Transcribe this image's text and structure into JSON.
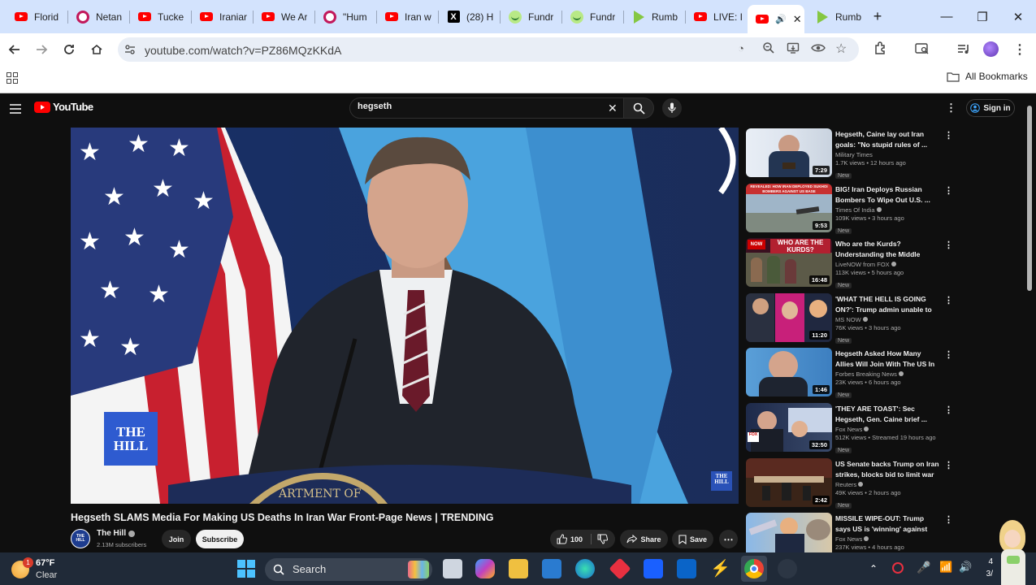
{
  "browser": {
    "tabs": [
      {
        "title": "Florid",
        "icon": "youtube-icon"
      },
      {
        "title": "Netan",
        "icon": "ring-icon"
      },
      {
        "title": "Tucke",
        "icon": "youtube-icon"
      },
      {
        "title": "Iraniar",
        "icon": "youtube-icon"
      },
      {
        "title": "We Ar",
        "icon": "youtube-icon"
      },
      {
        "title": "\"Hum",
        "icon": "ring-icon"
      },
      {
        "title": "Iran w",
        "icon": "youtube-icon"
      },
      {
        "title": "(28) H",
        "icon": "x-icon"
      },
      {
        "title": "Fundr",
        "icon": "fundraise-icon"
      },
      {
        "title": "Fundr",
        "icon": "fundraise-icon"
      },
      {
        "title": "Rumb",
        "icon": "rumble-icon"
      },
      {
        "title": "LIVE: I",
        "icon": "youtube-icon"
      },
      {
        "title": "",
        "icon": "youtube-icon"
      },
      {
        "title": "Rumb",
        "icon": "rumble-icon"
      }
    ],
    "url": "youtube.com/watch?v=PZ86MQzKKdA",
    "bookmarks_label": "All Bookmarks"
  },
  "youtube": {
    "logo_text": "YouTube",
    "search_value": "hegseth",
    "sign_in_label": "Sign in",
    "video": {
      "title": "Hegseth SLAMS Media For Making US Deaths In Iran War Front-Page News | TRENDING",
      "channel": "The Hill",
      "subscribers": "2.13M subscribers",
      "join_label": "Join",
      "subscribe_label": "Subscribe",
      "likes": "100",
      "share_label": "Share",
      "save_label": "Save",
      "watermark": "THE HILL",
      "podium_text": "ARTMENT OF"
    },
    "recommendations": [
      {
        "title": "Hegseth, Caine lay out Iran goals: \"No stupid rules of ...",
        "channel": "Military Times",
        "verified": false,
        "meta": "1.7K views • 12 hours ago",
        "duration": "7:29",
        "badge": "New"
      },
      {
        "title": "BIG! Iran Deploys Russian Bombers To Wipe Out U.S. ...",
        "channel": "Times Of India",
        "verified": true,
        "meta": "109K views • 3 hours ago",
        "duration": "9:53",
        "badge": "New"
      },
      {
        "title": "Who are the Kurds? Understanding the Middle East...",
        "channel": "LiveNOW from FOX",
        "verified": true,
        "meta": "113K views • 5 hours ago",
        "duration": "16:48",
        "badge": "New"
      },
      {
        "title": "'WHAT THE HELL IS GOING ON?': Trump admin unable to ...",
        "channel": "MS NOW",
        "verified": true,
        "meta": "76K views • 3 hours ago",
        "duration": "11:20",
        "badge": "New"
      },
      {
        "title": "Hegseth Asked How Many Allies Will Join With The US In ...",
        "channel": "Forbes Breaking News",
        "verified": true,
        "meta": "23K views • 6 hours ago",
        "duration": "1:46",
        "badge": "New"
      },
      {
        "title": "'THEY ARE TOAST': Sec Hegseth, Gen. Caine brief ...",
        "channel": "Fox News",
        "verified": true,
        "meta": "512K views • Streamed 19 hours ago",
        "duration": "32:50",
        "badge": "New"
      },
      {
        "title": "US Senate backs Trump on Iran strikes, blocks bid to limit war ...",
        "channel": "Reuters",
        "verified": true,
        "meta": "49K views • 2 hours ago",
        "duration": "2:42",
        "badge": "New"
      },
      {
        "title": "MISSILE WIPE-OUT: Trump says US is 'winning' against Iran as ...",
        "channel": "Fox News",
        "verified": true,
        "meta": "237K views • 4 hours ago",
        "duration": "",
        "badge": ""
      }
    ],
    "thumb_texts": [
      "REVEALED: HOW IRAN DEPLOYED SUKHOI BOMBERS AGAINST US BASE",
      "WHO ARE THE KURDS?"
    ]
  },
  "taskbar": {
    "weather_temp": "67°F",
    "weather_desc": "Clear",
    "weather_badge": "1",
    "search_label": "Search",
    "clock_time": "4",
    "clock_date": "3/"
  }
}
